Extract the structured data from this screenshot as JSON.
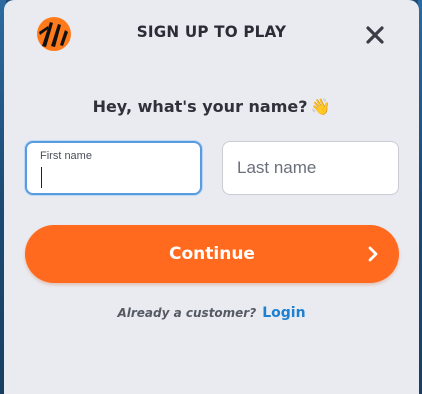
{
  "modal": {
    "title": "SIGN UP TO PLAY",
    "close_label": "×"
  },
  "prompt": {
    "text": "Hey, what's your name?",
    "emoji": "👋"
  },
  "form": {
    "first_name": {
      "label": "First name",
      "value": ""
    },
    "last_name": {
      "placeholder": "Last name",
      "value": ""
    }
  },
  "continue_button": {
    "label": "Continue",
    "icon": "chevron-right-icon"
  },
  "footer": {
    "question": "Already a customer?",
    "login_label": "Login"
  },
  "colors": {
    "accent": "#ff6a1f",
    "link": "#1f7fd0",
    "focus": "#5a9be0",
    "modal_bg": "#eaebf0"
  },
  "icons": {
    "logo": "tiger-logo-icon",
    "close": "close-icon"
  }
}
